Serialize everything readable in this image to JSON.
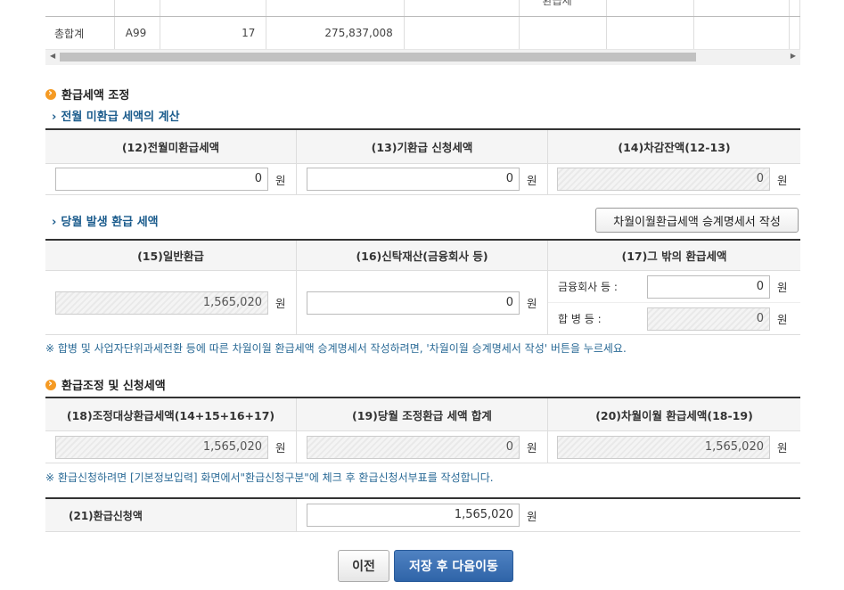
{
  "top_table": {
    "cut_header": "환급세",
    "row": {
      "label": "총합계",
      "code": "A99",
      "count": "17",
      "amount": "275,837,008"
    }
  },
  "section_refund_adjust": {
    "title": "환급세액 조정",
    "sub_prev": "전월 미환급 세액의 계산",
    "headers": [
      "(12)전월미환급세액",
      "(13)기환급 신청세액",
      "(14)차감잔액(12-13)"
    ],
    "values": [
      "0",
      "0",
      "0"
    ],
    "unit": "원",
    "sub_curr": "당월 발생 환급 세액",
    "carry_button": "차월이월환급세액 승계명세서 작성",
    "headers2": [
      "(15)일반환급",
      "(16)신탁재산(금융회사 등)",
      "(17)그 밖의 환급세액"
    ],
    "general_refund": "1,565,020",
    "trust_refund": "0",
    "other_label_1": "금융회사 등 :",
    "other_value_1": "0",
    "other_label_2": "합 병 등 :",
    "other_value_2": "0",
    "note": "※ 합병 및 사업자단위과세전환 등에 따른 차월이월 환급세액 승계명세서 작성하려면, '차월이월 승계명세서 작성' 버튼을 누르세요."
  },
  "section_apply": {
    "title": "환급조정 및 신청세액",
    "headers": [
      "(18)조정대상환급세액(14+15+16+17)",
      "(19)당월 조정환급 세액 합계",
      "(20)차월이월 환급세액(18-19)"
    ],
    "values": [
      "1,565,020",
      "0",
      "1,565,020"
    ],
    "note": "※ 환급신청하려면 [기본정보입력] 화면에서\"환급신청구분\"에 체크 후 환급신청서부표를 작성합니다.",
    "apply_label": "(21)환급신청액",
    "apply_value": "1,565,020"
  },
  "buttons": {
    "prev": "이전",
    "next": "저장 후 다음이동"
  }
}
